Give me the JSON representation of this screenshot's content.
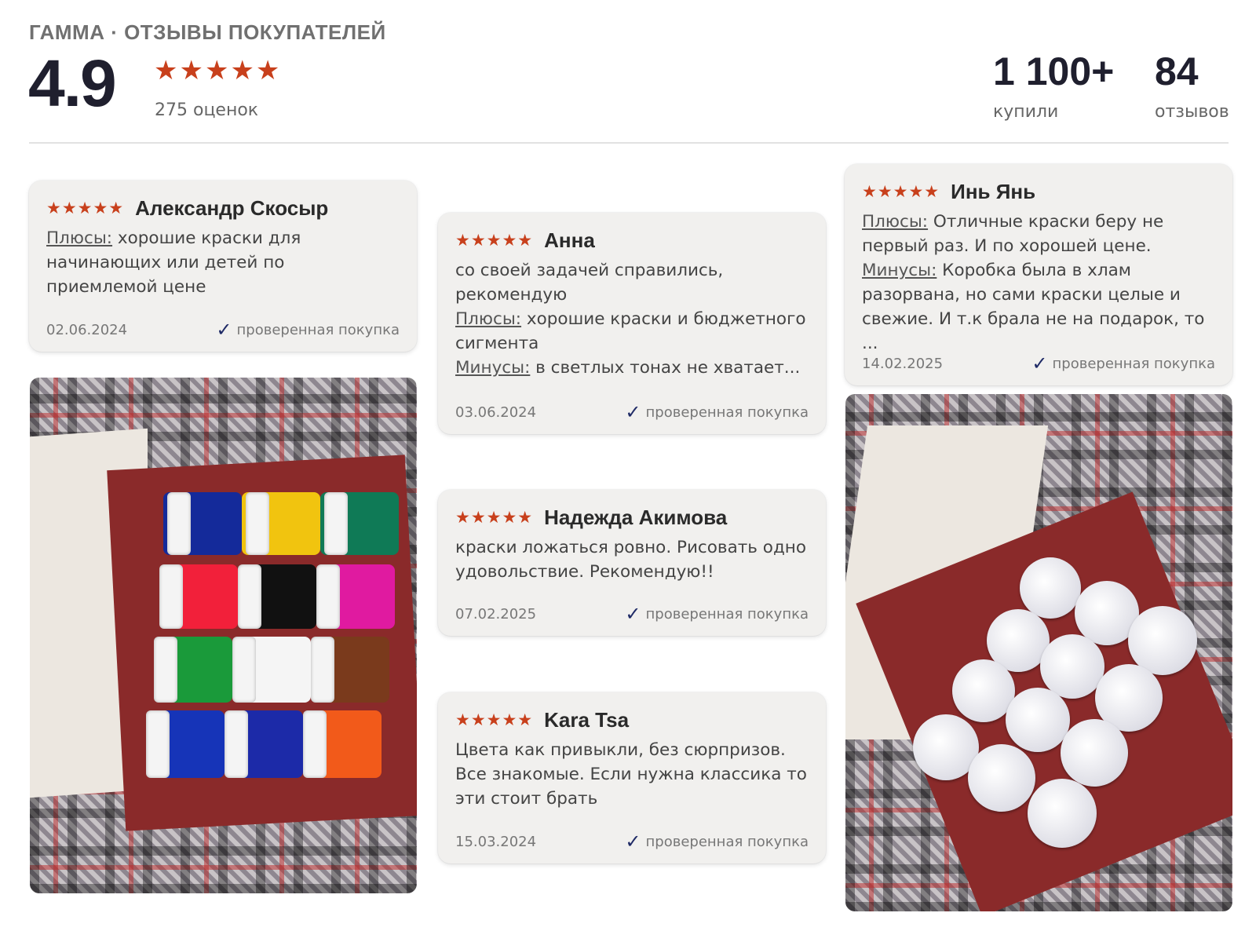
{
  "header": {
    "brand": "ГАММА · ОТЗЫВЫ ПОКУПАТЕЛЕЙ",
    "rating_value": "4.9",
    "rating_stars": "★★★★★",
    "rating_count": "275 оценок",
    "bought_num": "1 100+",
    "bought_label": "купили",
    "reviews_num": "84",
    "reviews_label": "отзывов"
  },
  "colors": {
    "accent_star": "#c8401c",
    "check": "#1f2a66",
    "card_bg": "#f1f0ee"
  },
  "reviews": [
    {
      "stars": "★★★★★",
      "author": "Александр Скосыр",
      "pros_label": "Плюсы:",
      "pros": " хорошие краски для начинающих или детей по приемлемой цене",
      "date": "02.06.2024",
      "verified": "проверенная покупка"
    },
    {
      "stars": "★★★★★",
      "author": "Анна",
      "text": "со своей задачей справились, рекомендую",
      "pros_label": "Плюсы:",
      "pros": " хорошие краски и бюджетного сигмента",
      "cons_label": "Минусы:",
      "cons": " в светлых тонах не хватает...",
      "date": "03.06.2024",
      "verified": "проверенная покупка"
    },
    {
      "stars": "★★★★★",
      "author": "Надежда Акимова",
      "text": "краски ложаться ровно. Рисовать одно удовольствие. Рекомендую!!",
      "date": "07.02.2025",
      "verified": "проверенная покупка"
    },
    {
      "stars": "★★★★★",
      "author": "Kara Tsa",
      "text": "Цвета как привыкли, без сюрпризов. Все знакомые. Если нужна классика то эти стоит брать",
      "date": "15.03.2024",
      "verified": "проверенная покупка"
    },
    {
      "stars": "★★★★★",
      "author": "Инь Янь",
      "pros_label": "Плюсы:",
      "pros": " Отличные краски беру не первый раз. И по хорошей цене.",
      "cons_label": "Минусы:",
      "cons": " Коробка была в хлам разорвана, но сами краски целые и свежие. И т.к брала не на подарок, то ...",
      "date": "14.02.2025",
      "verified": "проверенная покупка"
    }
  ],
  "icons": {
    "star": "star-icon",
    "check": "check-icon"
  }
}
